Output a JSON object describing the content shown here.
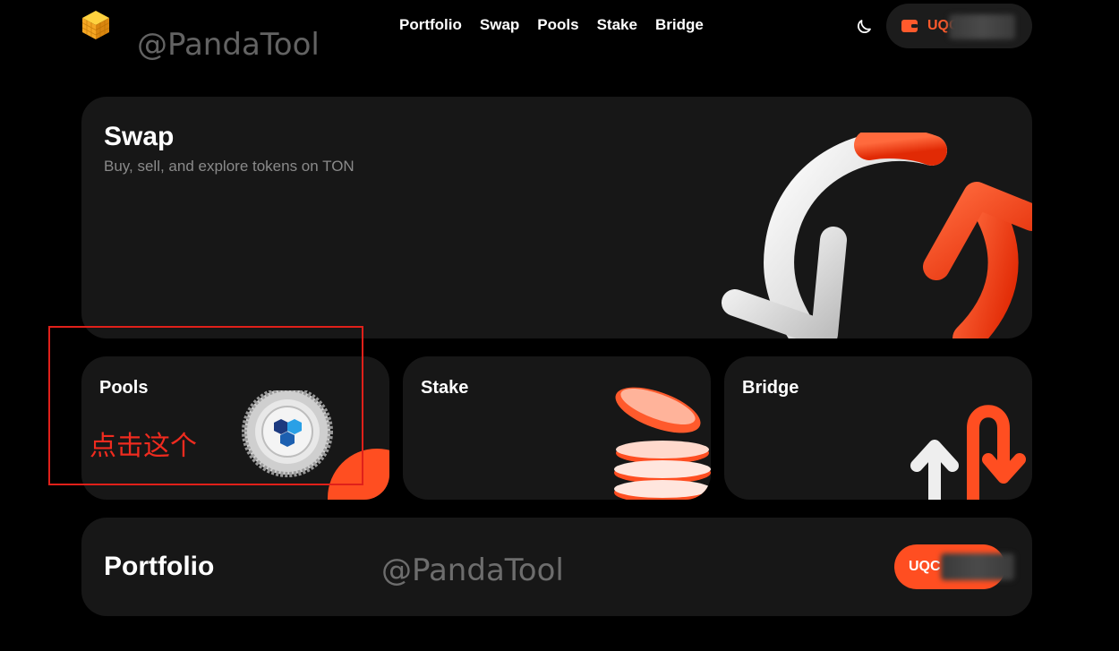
{
  "nav": {
    "links": [
      "Portfolio",
      "Swap",
      "Pools",
      "Stake",
      "Bridge"
    ],
    "wallet_address": "UQC"
  },
  "watermarks": [
    "@PandaTool",
    "@PandaTool"
  ],
  "swap": {
    "title": "Swap",
    "subtitle": "Buy, sell, and explore tokens on TON"
  },
  "pools": {
    "title": "Pools"
  },
  "stake": {
    "title": "Stake"
  },
  "bridge": {
    "title": "Bridge"
  },
  "portfolio": {
    "title": "Portfolio",
    "button_label": "UQC"
  },
  "annotation": {
    "text": "点击这个"
  },
  "colors": {
    "accent": "#ff4e21",
    "card": "#171717",
    "annotation": "#e0201a"
  }
}
